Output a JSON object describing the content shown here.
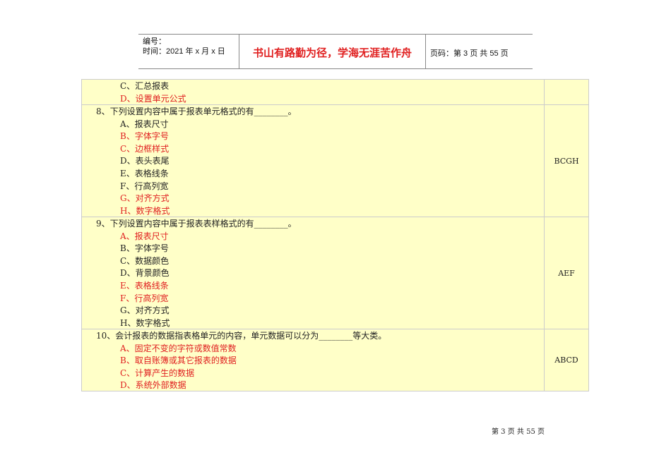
{
  "header": {
    "number_label": "编号：",
    "date_label": "时间：2021 年 x 月 x 日",
    "motto": "书山有路勤为径，学海无涯苦作舟",
    "page_label": "页码：第 3 页  共 55 页"
  },
  "rows": [
    {
      "question": null,
      "answer": "",
      "options": [
        {
          "text": "C、汇总报表",
          "correct": false
        },
        {
          "text": "D、设置单元公式",
          "correct": true
        }
      ]
    },
    {
      "question": "8、下列设置内容中属于报表单元格式的有________。",
      "answer": "BCGH",
      "options": [
        {
          "text": "A、报表尺寸",
          "correct": false
        },
        {
          "text": "B、字体字号",
          "correct": true
        },
        {
          "text": "C、边框样式",
          "correct": true
        },
        {
          "text": "D、表头表尾",
          "correct": false
        },
        {
          "text": "E、表格线条",
          "correct": false
        },
        {
          "text": "F、行高列宽",
          "correct": false
        },
        {
          "text": "G、对齐方式",
          "correct": true
        },
        {
          "text": "H、数字格式",
          "correct": true
        }
      ]
    },
    {
      "question": "9、下列设置内容中属于报表表样格式的有________。",
      "answer": "AEF",
      "options": [
        {
          "text": "A、报表尺寸",
          "correct": true
        },
        {
          "text": "B、字体字号",
          "correct": false
        },
        {
          "text": "C、数据颜色",
          "correct": false
        },
        {
          "text": "D、背景颜色",
          "correct": false
        },
        {
          "text": "E、表格线条",
          "correct": true
        },
        {
          "text": "F、行高列宽",
          "correct": true
        },
        {
          "text": "G、对齐方式",
          "correct": false
        },
        {
          "text": "H、数字格式",
          "correct": false
        }
      ]
    },
    {
      "question": "10、会计报表的数据指表格单元的内容，单元数据可以分为________等大类。",
      "answer": "ABCD",
      "options": [
        {
          "text": "A、固定不变的字符或数值常数",
          "correct": true
        },
        {
          "text": "B、取自账簿或其它报表的数据",
          "correct": true
        },
        {
          "text": "C、计算产生的数据",
          "correct": true
        },
        {
          "text": "D、系统外部数据",
          "correct": true
        }
      ]
    }
  ],
  "footer": "第 3 页 共 55 页"
}
